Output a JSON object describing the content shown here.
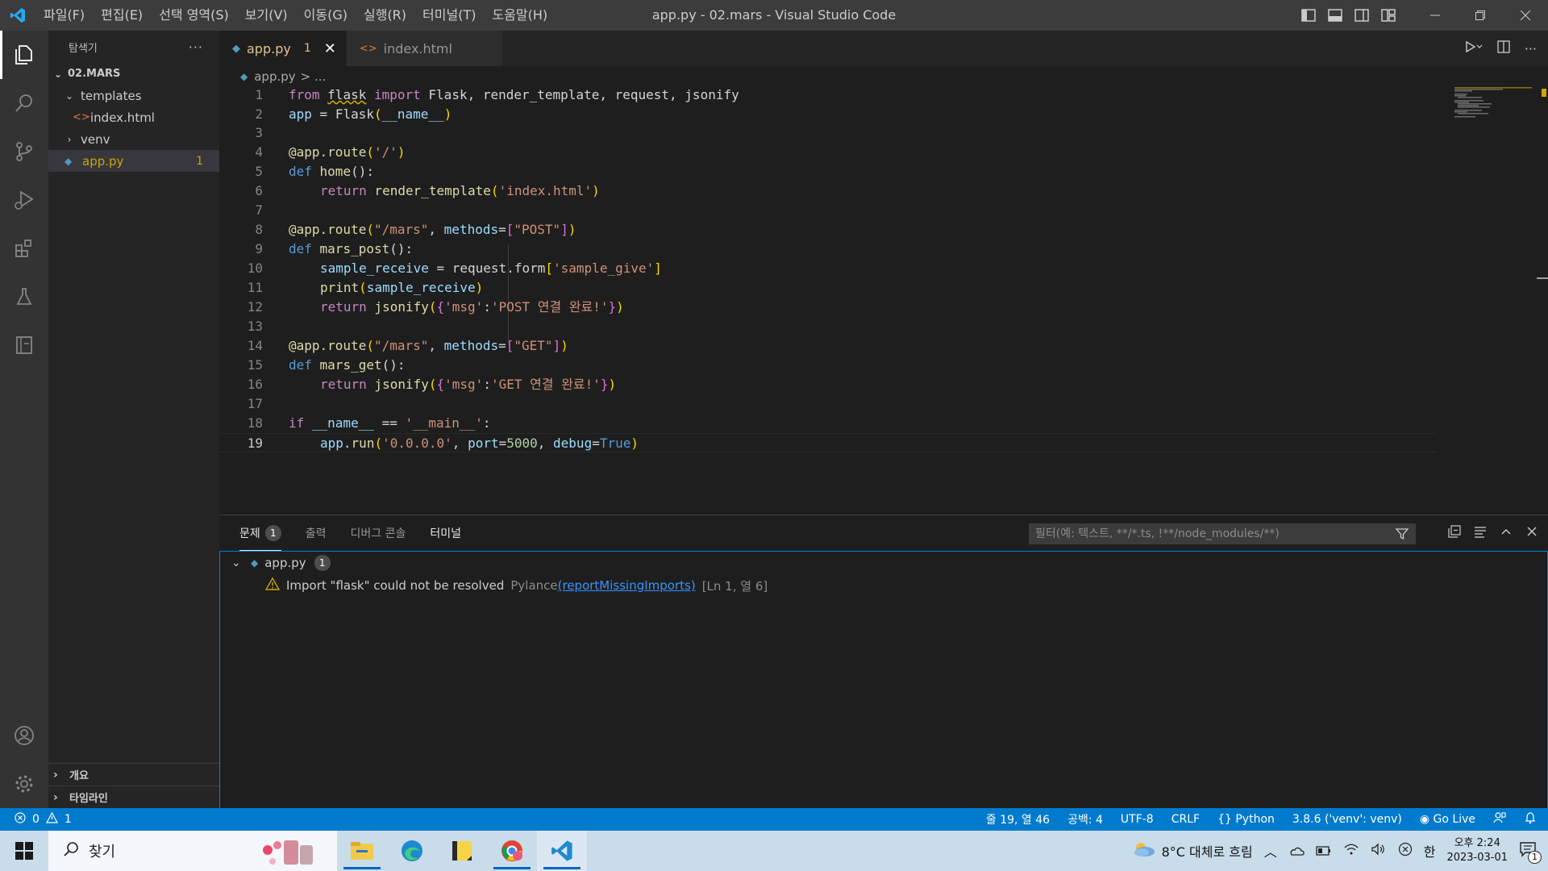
{
  "titlebar": {
    "menu": [
      "파일(F)",
      "편집(E)",
      "선택 영역(S)",
      "보기(V)",
      "이동(G)",
      "실행(R)",
      "터미널(T)",
      "도움말(H)"
    ],
    "window_title": "app.py - 02.mars - Visual Studio Code"
  },
  "sidebar": {
    "header": "탐색기",
    "more": "···",
    "root": "02.MARS",
    "tree": {
      "templates": "templates",
      "index_html": "index.html",
      "venv": "venv",
      "app_py": "app.py",
      "app_py_badge": "1"
    },
    "outline": "개요",
    "timeline": "타임라인"
  },
  "tabs": {
    "active": {
      "label": "app.py",
      "badge": "1"
    },
    "inactive": {
      "label": "index.html"
    }
  },
  "breadcrumb": {
    "file": "app.py",
    "rest": "> ..."
  },
  "editor": {
    "line_numbers": [
      "1",
      "2",
      "3",
      "4",
      "5",
      "6",
      "7",
      "8",
      "9",
      "10",
      "11",
      "12",
      "13",
      "14",
      "15",
      "16",
      "17",
      "18",
      "19"
    ],
    "code": {
      "l1": {
        "from": "from",
        "mod": "flask",
        "imp": "import",
        "rest": " Flask, render_template, request, jsonify"
      },
      "l2": {
        "a": "app",
        "b": " = ",
        "c": "Flask",
        "d": "(",
        "e": "__name__",
        "f": ")"
      },
      "l4": {
        "deco": "@app.route",
        "p1": "(",
        "s": "'/'",
        "p2": ")"
      },
      "l5": {
        "def": "def",
        "name": " home",
        "p": "():"
      },
      "l6": {
        "ret": "return",
        "fn": " render_template",
        "p1": "(",
        "s": "'index.html'",
        "p2": ")"
      },
      "l8": {
        "deco": "@app.route",
        "p1": "(",
        "s": "\"/mars\"",
        "c": ", ",
        "k": "methods",
        "eq": "=",
        "b1": "[",
        "v": "\"POST\"",
        "b2": "]",
        "p2": ")"
      },
      "l9": {
        "def": "def",
        "name": " mars_post",
        "p": "():"
      },
      "l10": {
        "v": "sample_receive",
        "eq": " = ",
        "obj": "request",
        "dot": ".",
        "attr": "form",
        "b1": "[",
        "s": "'sample_give'",
        "b2": "]"
      },
      "l11": {
        "fn": "print",
        "p1": "(",
        "v": "sample_receive",
        "p2": ")"
      },
      "l12": {
        "ret": "return",
        "fn": " jsonify",
        "p1": "(",
        "b1": "{",
        "k": "'msg'",
        "c": ":",
        "s": "'POST 연결 완료!'",
        "b2": "}",
        "p2": ")"
      },
      "l14": {
        "deco": "@app.route",
        "p1": "(",
        "s": "\"/mars\"",
        "c": ", ",
        "k": "methods",
        "eq": "=",
        "b1": "[",
        "v": "\"GET\"",
        "b2": "]",
        "p2": ")"
      },
      "l15": {
        "def": "def",
        "name": " mars_get",
        "p": "():"
      },
      "l16": {
        "ret": "return",
        "fn": " jsonify",
        "p1": "(",
        "b1": "{",
        "k": "'msg'",
        "c": ":",
        "s": "'GET 연결 완료!'",
        "b2": "}",
        "p2": ")"
      },
      "l18": {
        "if": "if",
        "n": " __name__",
        "eq": " == ",
        "s": "'__main__'",
        "c": ":"
      },
      "l19": {
        "obj": "app",
        "dot": ".",
        "fn": "run",
        "p1": "(",
        "s": "'0.0.0.0'",
        "c1": ", ",
        "k1": "port",
        "eq1": "=",
        "n": "5000",
        "c2": ", ",
        "k2": "debug",
        "eq2": "=",
        "t": "True",
        "p2": ")"
      }
    }
  },
  "panel": {
    "tabs": {
      "problems": "문제",
      "problems_count": "1",
      "output": "출력",
      "debug_console": "디버그 콘솔",
      "terminal": "터미널"
    },
    "filter_placeholder": "필터(예: 텍스트, **/*.ts, !**/node_modules/**)",
    "problems": {
      "file": "app.py",
      "file_count": "1",
      "message": "Import \"flask\" could not be resolved",
      "source": "Pylance",
      "code": "(reportMissingImports)",
      "position": "[Ln 1, 열 6]"
    }
  },
  "statusbar": {
    "errors": "0",
    "warnings": "1",
    "position": "줄 19, 열 46",
    "spaces": "공백: 4",
    "encoding": "UTF-8",
    "eol": "CRLF",
    "language": "Python",
    "interpreter": "3.8.6 ('venv': venv)",
    "golive": "Go Live"
  },
  "taskbar": {
    "search": "찾기",
    "weather": "8°C  대체로 흐림",
    "ime": "한",
    "time": "오후 2:24",
    "date": "2023-03-01",
    "notif_count": "1"
  },
  "colors": {
    "accent": "#007acc",
    "warning": "#cca700",
    "tab_active_text": "#e2c08d"
  }
}
